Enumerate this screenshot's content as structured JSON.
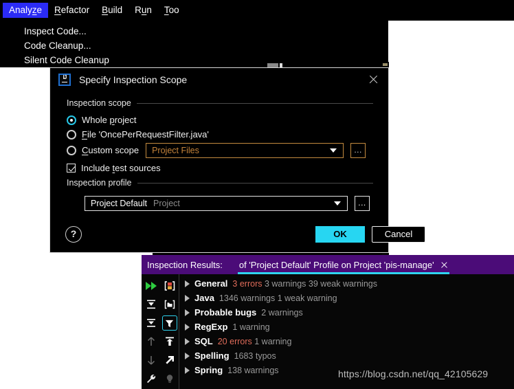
{
  "menubar": {
    "items": [
      {
        "label": "Analyze",
        "mnemonic_index": 5,
        "selected": true
      },
      {
        "label": "Refactor",
        "mnemonic_index": 0,
        "selected": false
      },
      {
        "label": "Build",
        "mnemonic_index": 0,
        "selected": false
      },
      {
        "label": "Run",
        "mnemonic_index": 1,
        "selected": false
      },
      {
        "label": "Too",
        "mnemonic_index": 0,
        "selected": false
      }
    ]
  },
  "analyze_menu": {
    "items": [
      {
        "label": "Inspect Code..."
      },
      {
        "label": "Code Cleanup..."
      },
      {
        "label": "Silent Code Cleanup"
      }
    ]
  },
  "dialog": {
    "icon": "intellij-idea-icon",
    "title": "Specify Inspection Scope",
    "close_icon": "close-icon",
    "scope_group": {
      "title": "Inspection scope",
      "options": [
        {
          "label": "Whole project",
          "selected": true
        },
        {
          "label": "File 'OncePerRequestFilter.java'",
          "selected": false
        },
        {
          "label": "Custom scope",
          "selected": false
        }
      ],
      "custom_scope_combo": {
        "value": "Project Files",
        "caret_icon": "chevron-down-icon",
        "browse_label": "...",
        "border_color": "#c48b3f",
        "text_color": "#c4833a"
      },
      "include_test_sources": {
        "label": "Include test sources",
        "checked": true
      }
    },
    "profile_group": {
      "title": "Inspection profile",
      "combo": {
        "value": "Project Default",
        "suffix": "Project",
        "caret_icon": "chevron-down-icon",
        "browse_label": "..."
      }
    },
    "footer": {
      "help_label": "?",
      "ok_label": "OK",
      "cancel_label": "Cancel",
      "ok_color": "#27d6f2"
    }
  },
  "results": {
    "header": {
      "label": "Inspection Results:",
      "tab_title": "of 'Project Default' Profile on Project 'pis-manage'",
      "tab_close_icon": "close-icon",
      "background": "#4b0c78",
      "underline_color": "#2fd4ef"
    },
    "toolbar": {
      "left": [
        {
          "name": "rerun-icon",
          "label": "Rerun"
        },
        {
          "name": "expand-all-icon",
          "label": "Expand All"
        },
        {
          "name": "collapse-all-icon",
          "label": "Collapse All"
        },
        {
          "name": "previous-occurrence-icon",
          "label": "Previous"
        },
        {
          "name": "next-occurrence-icon",
          "label": "Next"
        },
        {
          "name": "settings-wrench-icon",
          "label": "Settings"
        }
      ],
      "right": [
        {
          "name": "group-by-severity-icon",
          "label": "Group by Severity"
        },
        {
          "name": "group-by-directory-icon",
          "label": "Group by Directory"
        },
        {
          "name": "filter-icon",
          "label": "Filter Inspections",
          "active": true
        },
        {
          "name": "export-icon",
          "label": "Export"
        },
        {
          "name": "open-external-icon",
          "label": "Open in Browser"
        },
        {
          "name": "quick-fix-bulb-icon",
          "label": "Quick Fix"
        }
      ]
    },
    "tree": [
      {
        "name": "General",
        "meta": [
          {
            "text": "3 errors",
            "severity": "error"
          },
          {
            "text": "3 warnings",
            "severity": "normal"
          },
          {
            "text": "39 weak warnings",
            "severity": "normal"
          }
        ]
      },
      {
        "name": "Java",
        "meta": [
          {
            "text": "1346 warnings",
            "severity": "normal"
          },
          {
            "text": "1 weak warning",
            "severity": "normal"
          }
        ]
      },
      {
        "name": "Probable bugs",
        "meta": [
          {
            "text": "2 warnings",
            "severity": "normal"
          }
        ]
      },
      {
        "name": "RegExp",
        "meta": [
          {
            "text": "1 warning",
            "severity": "normal"
          }
        ]
      },
      {
        "name": "SQL",
        "meta": [
          {
            "text": "20 errors",
            "severity": "error"
          },
          {
            "text": "1 warning",
            "severity": "normal"
          }
        ]
      },
      {
        "name": "Spelling",
        "meta": [
          {
            "text": "1683 typos",
            "severity": "normal"
          }
        ]
      },
      {
        "name": "Spring",
        "meta": [
          {
            "text": "138 warnings",
            "severity": "normal"
          }
        ]
      }
    ]
  },
  "watermark": "https://blog.csdn.net/qq_42105629"
}
